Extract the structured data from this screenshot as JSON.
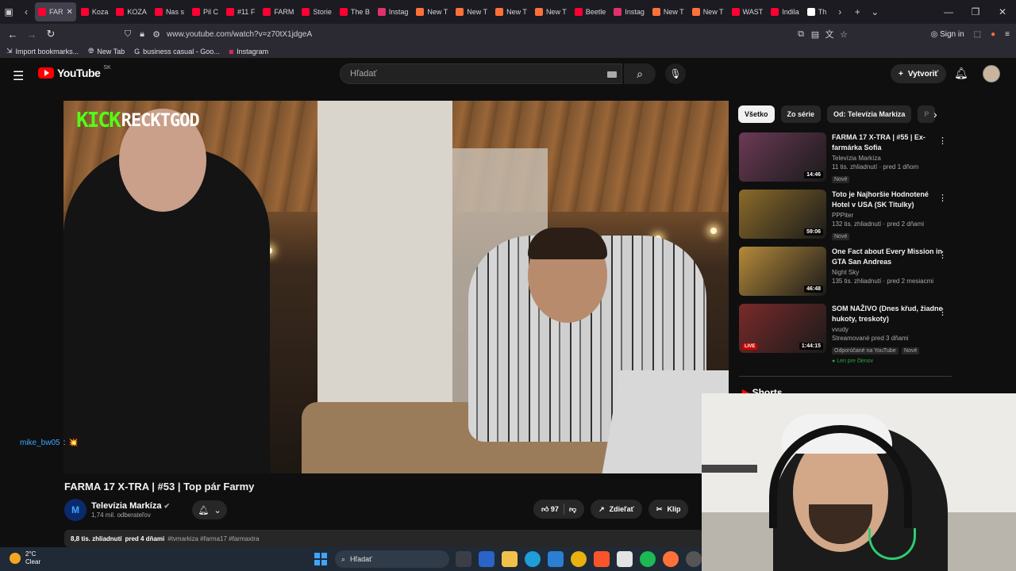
{
  "browser": {
    "tabs": [
      {
        "label": "FAR",
        "color": "#ff0033",
        "active": true
      },
      {
        "label": "Koza",
        "color": "#ff0033"
      },
      {
        "label": "KOZA",
        "color": "#ff0033"
      },
      {
        "label": "Nas s",
        "color": "#ff0033"
      },
      {
        "label": "Pil C",
        "color": "#ff0033"
      },
      {
        "label": "#11 F",
        "color": "#ff0033"
      },
      {
        "label": "FARM",
        "color": "#ff0033"
      },
      {
        "label": "Storie",
        "color": "#ff0033"
      },
      {
        "label": "The B",
        "color": "#ff0033"
      },
      {
        "label": "Instag",
        "color": "#e1306c"
      },
      {
        "label": "New T",
        "color": "#ff7139"
      },
      {
        "label": "New T",
        "color": "#ff7139"
      },
      {
        "label": "New T",
        "color": "#ff7139"
      },
      {
        "label": "New T",
        "color": "#ff7139"
      },
      {
        "label": "Beetle",
        "color": "#ff0033"
      },
      {
        "label": "Instag",
        "color": "#e1306c"
      },
      {
        "label": "New T",
        "color": "#ff7139"
      },
      {
        "label": "New T",
        "color": "#ff7139"
      },
      {
        "label": "WAST",
        "color": "#ff0033"
      },
      {
        "label": "Indila",
        "color": "#ff0033"
      },
      {
        "label": "Th",
        "color": "#ffffff"
      }
    ],
    "url": "www.youtube.com/watch?v=z70tX1jdgeA",
    "sign_in": "Sign in",
    "bookmarks": [
      {
        "label": "Import bookmarks...",
        "icon": "import-icon"
      },
      {
        "label": "New Tab",
        "icon": "globe-icon"
      },
      {
        "label": "business casual - Goo...",
        "icon": "google-icon"
      },
      {
        "label": "Instagram",
        "icon": "instagram-icon"
      }
    ]
  },
  "youtube": {
    "logo_text": "YouTube",
    "country": "SK",
    "search_placeholder": "Hľadať",
    "create_label": "Vytvoriť"
  },
  "video": {
    "overlay_brand": "KICK",
    "overlay_streamer": "RECKTGOD",
    "chat_user": "mike_bw05",
    "chat_sep": ":",
    "chat_emote": "💥",
    "title": "FARMA 17 X-TRA | #53 | Top pár Farmy",
    "channel_initial": "M",
    "channel_name": "Televízia Markíza",
    "channel_subs": "1,74 mil. odberateľov",
    "likes": "97",
    "share_label": "Zdieľať",
    "clip_label": "Klip",
    "views": "8,8 tis. zhliadnutí",
    "age": "pred 4 dňami",
    "hashtags": "#tvmarkiza #farma17 #farmaxtra"
  },
  "sidebar": {
    "chips": [
      "Všetko",
      "Zo série",
      "Od: Televízia Markíza",
      "P"
    ],
    "recommendations": [
      {
        "title": "FARMA 17 X-TRA | #55 | Ex-farmárka Sofia",
        "channel": "Televízia Markíza",
        "meta": "11 tis. zhliadnutí · pred 1 dňom",
        "duration": "14:46",
        "badge": "Nové",
        "thumb_color": "#6b3a55"
      },
      {
        "title": "Toto je Najhoršie Hodnotené Hotel v USA (SK Titulky)",
        "channel": "PPPiter",
        "meta": "132 tis. zhliadnutí · pred 2 dňami",
        "duration": "59:06",
        "badge": "Nové",
        "thumb_color": "#8a6b2a"
      },
      {
        "title": "One Fact about Every Mission in GTA San Andreas",
        "channel": "Night Sky",
        "meta": "135 tis. zhliadnutí · pred 2 mesiacmi",
        "duration": "46:48",
        "badge": "",
        "thumb_color": "#b58a3a"
      },
      {
        "title": "SOM NAŽIVO (Dnes křud, žiadne hukoty, treskoty)",
        "channel": "vvudy",
        "meta": "Streamované pred 3 dňami",
        "duration": "1:44:15",
        "badge": "Odporúčané na YouTube",
        "badge2": "Nové",
        "members": "Len pre členov",
        "live": "LIVE",
        "thumb_color": "#7a2a2a"
      }
    ],
    "shorts_label": "Shorts"
  },
  "taskbar": {
    "temp": "2°C",
    "condition": "Clear",
    "search_label": "Hľadať"
  }
}
